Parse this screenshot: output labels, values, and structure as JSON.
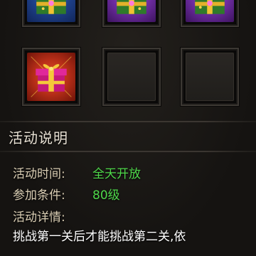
{
  "rewards": [
    {
      "kind": "blue-gift-box-icon"
    },
    {
      "kind": "purple-gift-box-icon"
    },
    {
      "kind": "purple-gift-box-icon"
    },
    {
      "kind": "red-gift-box-icon"
    },
    {
      "kind": "empty"
    },
    {
      "kind": "empty"
    }
  ],
  "section": {
    "title": "活动说明"
  },
  "info": {
    "time_label": "活动时间:",
    "time_value": "全天开放",
    "condition_label": "参加条件:",
    "condition_value": "80级",
    "detail_label": "活动详情:",
    "detail_text": "挑战第一关后才能挑战第二关,依"
  },
  "colors": {
    "value_green": "#4fd84a",
    "label_tan": "#d9cdb3",
    "title": "#e8e1d4"
  }
}
